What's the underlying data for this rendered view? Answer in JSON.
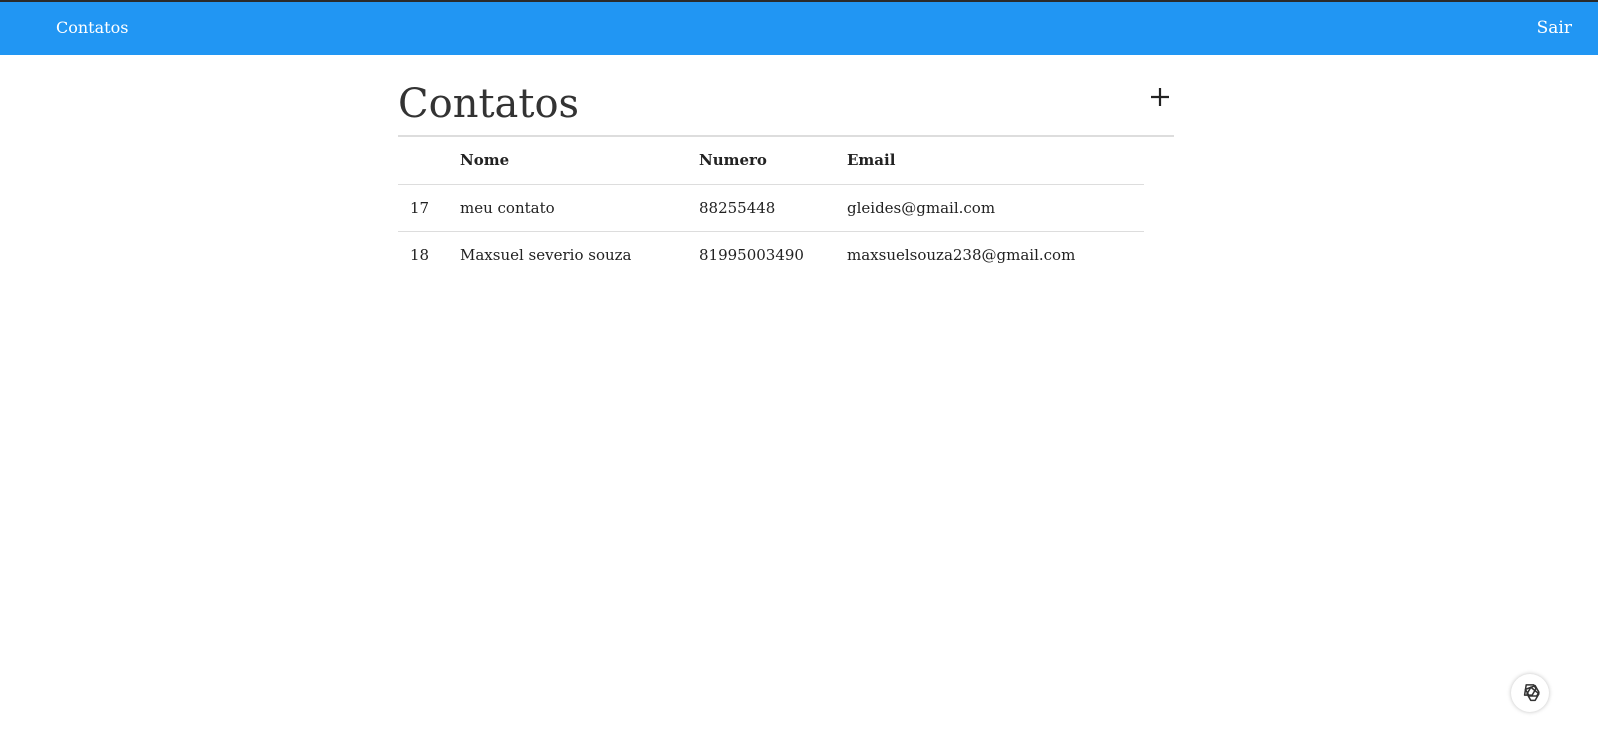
{
  "navbar": {
    "brand": "Contatos",
    "logout_label": "Sair",
    "background_color": "#2196f3"
  },
  "main": {
    "title": "Contatos",
    "add_icon": "plus-icon"
  },
  "table": {
    "headers": [
      "",
      "Nome",
      "Numero",
      "Email"
    ],
    "rows": [
      {
        "id": "17",
        "nome": "meu contato",
        "numero": "88255448",
        "email": "gleides@gmail.com"
      },
      {
        "id": "18",
        "nome": "Maxsuel severio souza",
        "numero": "81995003490",
        "email": "maxsuelsouza238@gmail.com"
      }
    ]
  },
  "floating_button": {
    "icon": "openai-logo-icon"
  }
}
